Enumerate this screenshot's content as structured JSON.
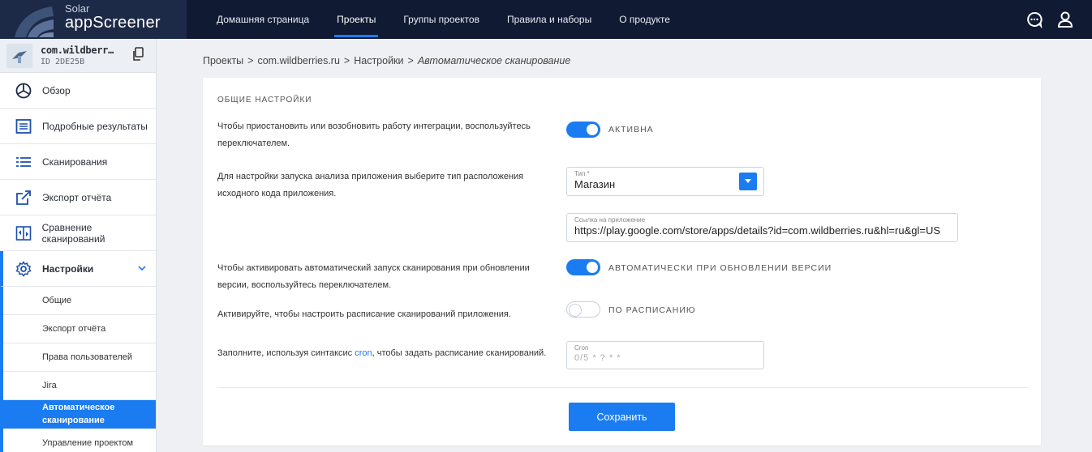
{
  "brand": {
    "small": "Solar",
    "big": "appScreener"
  },
  "nav": [
    {
      "label": "Домашняя страница",
      "active": false
    },
    {
      "label": "Проекты",
      "active": true
    },
    {
      "label": "Группы проектов",
      "active": false
    },
    {
      "label": "Правила и наборы",
      "active": false
    },
    {
      "label": "О продукте",
      "active": false
    }
  ],
  "project": {
    "name": "com.wildberr…",
    "id": "ID 2DE25B"
  },
  "sidebar": {
    "items": [
      {
        "label": "Обзор",
        "icon": "overview-icon"
      },
      {
        "label": "Подробные результаты",
        "icon": "detailed-results-icon"
      },
      {
        "label": "Сканирования",
        "icon": "scans-list-icon"
      },
      {
        "label": "Экспорт отчёта",
        "icon": "export-icon"
      },
      {
        "label": "Сравнение сканирований",
        "icon": "compare-icon"
      }
    ],
    "settings_label": "Настройки",
    "sub_items": [
      {
        "label": "Общие",
        "active": false
      },
      {
        "label": "Экспорт отчёта",
        "active": false
      },
      {
        "label": "Права пользователей",
        "active": false
      },
      {
        "label": "Jira",
        "active": false
      },
      {
        "label": "Автоматическое\nсканирование",
        "active": true
      },
      {
        "label": "Управление проектом",
        "active": false
      }
    ]
  },
  "breadcrumb": {
    "part1": "Проекты",
    "sep": ">",
    "part2": "com.wildberries.ru",
    "part3": "Настройки",
    "current": "Автоматическое сканирование"
  },
  "form": {
    "section_title": "ОБЩИЕ НАСТРОЙКИ",
    "integration_text": "Чтобы приостановить или возобновить работу интеграции, воспользуйтесь переключателем.",
    "integration_toggle_label": "АКТИВНА",
    "source_text": "Для настройки запуска анализа приложения выберите тип расположения исходного кода приложения.",
    "type_label": "Тип *",
    "type_value": "Магазин",
    "link_label": "Ссылка на приложение",
    "link_value": "https://play.google.com/store/apps/details?id=com.wildberries.ru&hl=ru&gl=US",
    "auto_text": "Чтобы активировать автоматический запуск сканирования при обновлении версии, воспользуйтесь переключателем.",
    "auto_toggle_label": "АВТОМАТИЧЕСКИ ПРИ ОБНОВЛЕНИИ ВЕРСИИ",
    "schedule_text": "Активируйте, чтобы настроить расписание сканирований приложения.",
    "schedule_toggle_label": "ПО РАСПИСАНИЮ",
    "cron_text_before": "Заполните, используя синтаксис ",
    "cron_link": "cron",
    "cron_text_after": ", чтобы задать расписание сканирований.",
    "cron_label": "Cron",
    "cron_placeholder": "0/5 * ? * *",
    "save_label": "Сохранить"
  },
  "colors": {
    "accent": "#1a7cf0",
    "topbar": "#101a33"
  }
}
